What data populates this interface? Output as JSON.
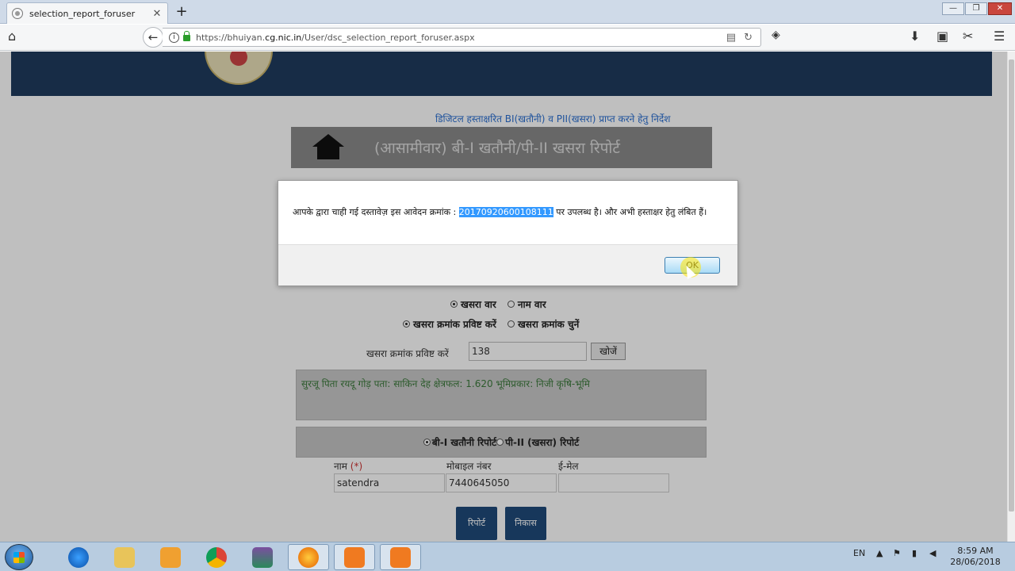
{
  "browser": {
    "tab_title": "selection_report_foruser",
    "tab_close": "✕",
    "new_tab": "+",
    "url_prefix": "https://bhuiyan.",
    "url_domain": "cg.nic.in",
    "url_path": "/User/dsc_selection_report_foruser.aspx"
  },
  "page": {
    "link_text": "डिजिटल हस्ताक्षरित BI(खतौनी) व PII(खसरा) प्राप्त करने हेतु निर्देश",
    "title": "(आसामीवार) बी-I खतौनी/पी-II खसरा रिपोर्ट",
    "search_mode": {
      "opt1": "खसरा वार",
      "opt2": "नाम वार",
      "selected": "खसरा वार"
    },
    "entry_mode": {
      "opt1": "खसरा क्रमांक प्रविष्ट करें",
      "opt2": "खसरा क्रमांक चुनें",
      "selected": "खसरा क्रमांक प्रविष्ट करें"
    },
    "khasra_label": "खसरा क्रमांक प्रविष्ट करें",
    "khasra_value": "138",
    "search_button": "खोजें",
    "owner_info": "सुरजू  पिता रयदू  गोड़ पता: साकिन देह  क्षेत्रफल: 1.620 भूमिप्रकार: निजी कृषि-भूमि",
    "report_type": {
      "opt1": "बी-I खतौनी रिपोर्ट",
      "opt2": "पी-II (खसरा) रिपोर्ट",
      "selected": "बी-I खतौनी रिपोर्ट"
    },
    "name_label": "नाम",
    "required_mark": "(*)",
    "mobile_label": "मोबाइल नंबर",
    "email_label": "ई-मेल",
    "name_value": "satendra",
    "mobile_value": "7440645050",
    "email_value": "",
    "report_button": "रिपोर्ट",
    "exit_button": "निकास"
  },
  "dialog": {
    "msg_before": "आपके द्वारा चाही गई दस्तावेज़ इस आवेदन क्रमांक : ",
    "application_no": "20170920600108111",
    "msg_after": " पर उपलब्ध है। और अभी हस्ताक्षर हेतु लंबित हैं।",
    "ok_label": "OK"
  },
  "taskbar": {
    "language": "EN",
    "time": "8:59 AM",
    "date": "28/06/2018"
  },
  "colors": {
    "header_band": "#1f3b5e",
    "title_box": "#8a8a8a",
    "link": "#2b6fd1",
    "owner_text": "#3c7a3c",
    "highlight": "#3399ff"
  }
}
